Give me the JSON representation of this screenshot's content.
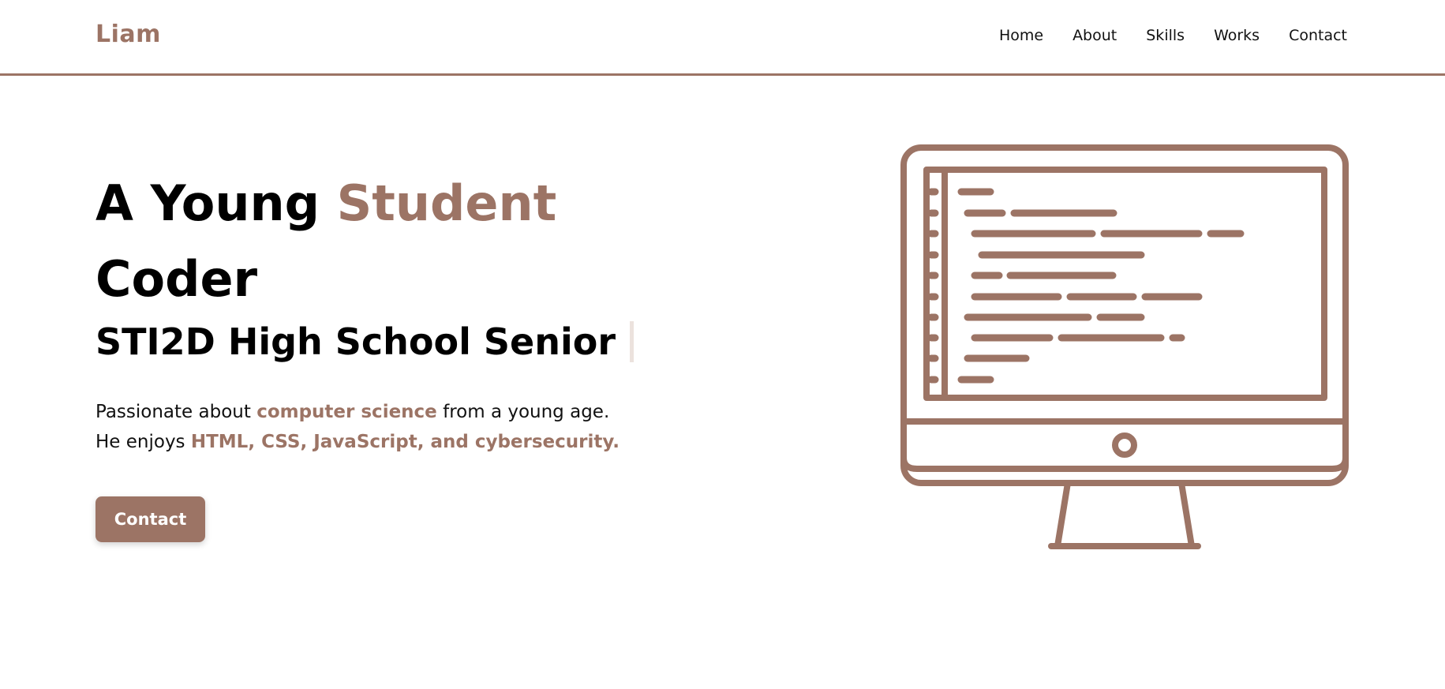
{
  "header": {
    "logo": "Liam",
    "nav": [
      "Home",
      "About",
      "Skills",
      "Works",
      "Contact"
    ]
  },
  "hero": {
    "headline_part1": "A Young ",
    "headline_accent": "Student",
    "headline_part2": "Coder",
    "subtitle": "STI2D High School Senior",
    "desc_line1_pre": "Passionate about ",
    "desc_line1_hl": "computer science",
    "desc_line1_post": " from a young age.",
    "desc_line2_pre": "He enjoys ",
    "desc_line2_hl": "HTML, CSS, JavaScript, and cybersecurity.",
    "button": "Contact"
  },
  "illustration": {
    "icon": "desktop-computer-code-icon"
  },
  "colors": {
    "accent": "#9c7465",
    "text": "#000000",
    "background": "#ffffff",
    "cursor": "#ece2dd"
  }
}
